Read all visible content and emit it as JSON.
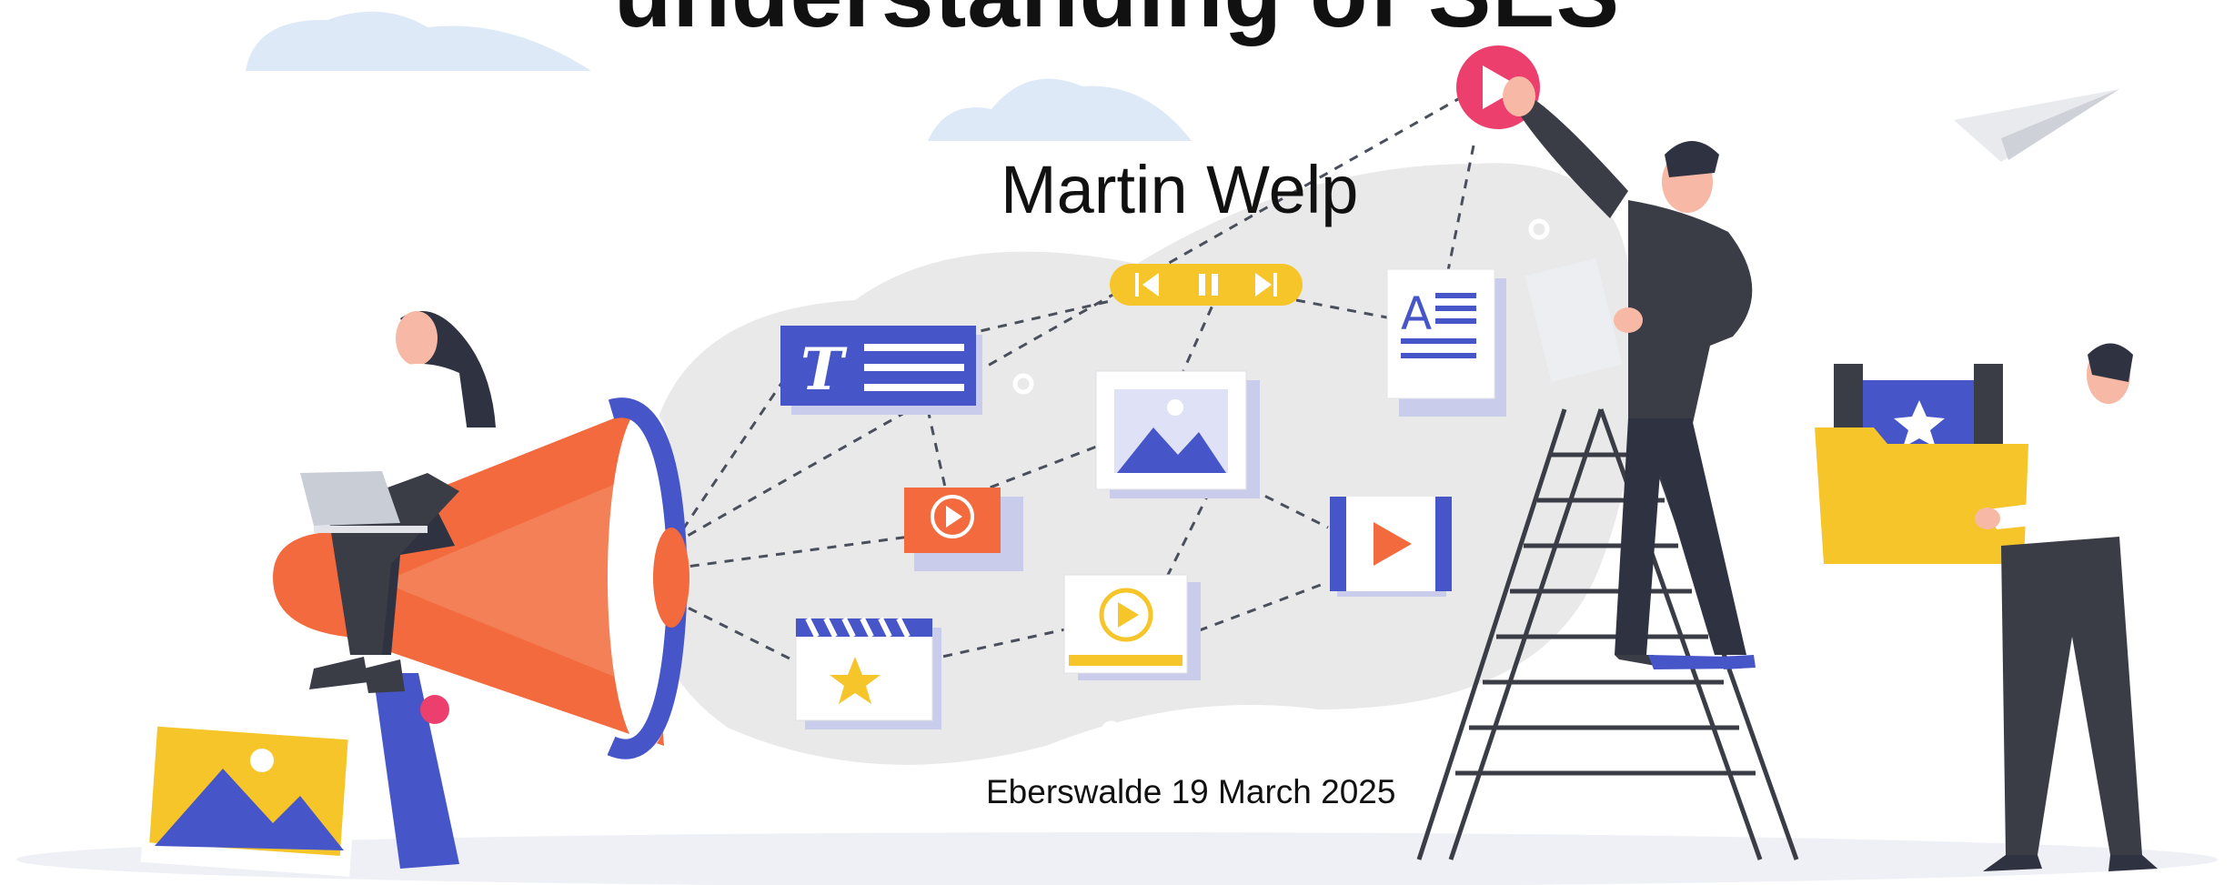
{
  "slide": {
    "title": "understanding of SES",
    "author": "Martin Welp",
    "place_date": "Eberswalde 19 March 2025"
  },
  "colors": {
    "blue": "#4656c8",
    "orange": "#f26a3d",
    "yellow": "#f5c52a",
    "pink": "#ec3f6e",
    "dark": "#3a3d46",
    "blob": "#e9e9ea"
  }
}
